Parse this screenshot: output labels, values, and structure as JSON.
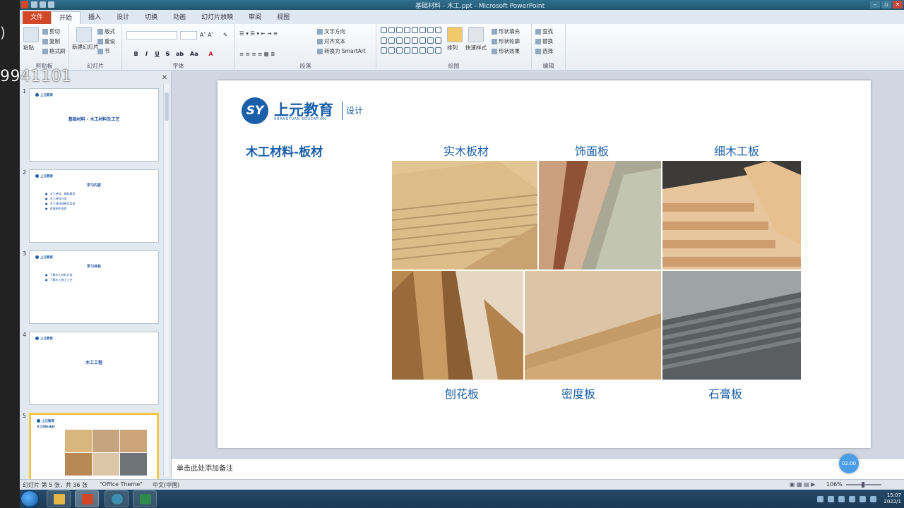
{
  "overlay": {
    "number": "9941101",
    "paren": ")"
  },
  "window": {
    "title": "基础材料 - 木工.ppt - Microsoft PowerPoint"
  },
  "tabs": [
    {
      "label": "文件",
      "active": false
    },
    {
      "label": "开始",
      "active": true
    },
    {
      "label": "插入",
      "active": false
    },
    {
      "label": "设计",
      "active": false
    },
    {
      "label": "切换",
      "active": false
    },
    {
      "label": "动画",
      "active": false
    },
    {
      "label": "幻灯片放映",
      "active": false
    },
    {
      "label": "审阅",
      "active": false
    },
    {
      "label": "视图",
      "active": false
    }
  ],
  "ribbon": {
    "clipboard": {
      "paste": "粘贴",
      "cut": "剪切",
      "copy": "复制",
      "painter": "格式刷",
      "label": "剪贴板"
    },
    "slides": {
      "new_slide": "新建幻灯片",
      "layout": "版式",
      "reset": "重设",
      "section": "节",
      "label": "幻灯片"
    },
    "font": {
      "label": "字体",
      "bold": "B",
      "italic": "I",
      "underline": "U",
      "strike": "S"
    },
    "paragraph": {
      "label": "段落",
      "text_direction": "文字方向",
      "align_text": "对齐文本",
      "smartart": "转换为 SmartArt"
    },
    "drawing": {
      "label": "绘图",
      "arrange": "排列",
      "quick_styles": "快速样式",
      "fill": "形状填充",
      "outline": "形状轮廓",
      "effects": "形状效果"
    },
    "editing": {
      "label": "编辑",
      "find": "查找",
      "replace": "替换",
      "select": "选择"
    }
  },
  "slides_panel": {
    "slides": [
      {
        "num": "1",
        "logo": "上元教育",
        "title": "基础材料 - 木工材料及工艺"
      },
      {
        "num": "2",
        "logo": "上元教育",
        "title": "学习内容",
        "bullets": [
          "木工材料、辅料概述",
          "木工材料分类",
          "木工材料规格及用途",
          "家具制作流程"
        ]
      },
      {
        "num": "3",
        "logo": "上元教育",
        "title": "学习目标",
        "bullets": [
          "了解木工材料分类",
          "了解木工施工工艺"
        ]
      },
      {
        "num": "4",
        "logo": "上元教育",
        "title": "木工工程"
      },
      {
        "num": "5",
        "logo": "上元教育",
        "title": "木工材料-板材"
      }
    ]
  },
  "slide": {
    "logo_mark": "SY",
    "logo_cn": "上元教育",
    "logo_en": "SHANGYUAN EDUCATION",
    "logo_tag": "设计",
    "heading": "木工材料-板材",
    "captions": [
      "实木板材",
      "饰面板",
      "细木工板",
      "刨花板",
      "密度板",
      "石膏板"
    ]
  },
  "notes": {
    "placeholder": "单击此处添加备注",
    "rec_label": "02:00"
  },
  "status": {
    "slide_info": "幻灯片 第 5 张，共 36 张",
    "theme": "\"Office Theme\"",
    "lang": "中文(中国)",
    "zoom": "106%"
  },
  "taskbar": {
    "time": "15:07",
    "date": "2022/1"
  },
  "colors": {
    "brand": "#1b5fa8",
    "file_tab": "#d24726",
    "selection": "#f2c744"
  }
}
